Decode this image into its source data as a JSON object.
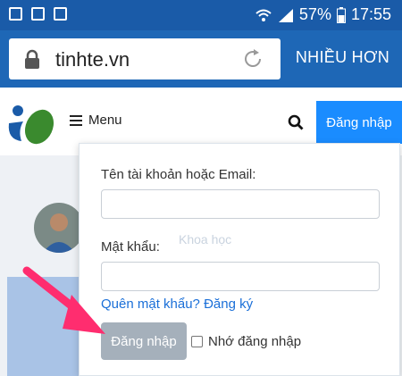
{
  "status": {
    "battery": "57%",
    "time": "17:55"
  },
  "browser": {
    "url": "tinhte.vn",
    "more_label": "NHIỀU HƠN"
  },
  "nav": {
    "menu_label": "Menu",
    "login_button": "Đăng nhập"
  },
  "login_form": {
    "username_label": "Tên tài khoản hoặc Email:",
    "username_value": "",
    "password_label": "Mật khẩu:",
    "password_value": "",
    "forgot_link": "Quên mật khẩu?",
    "register_link": "Đăng ký",
    "submit_label": "Đăng nhập",
    "remember_label": "Nhớ đăng nhập"
  },
  "background": {
    "ghost_text": "Khoa học"
  },
  "colors": {
    "brand_blue": "#1a8cff",
    "status_bar": "#1a5ba8",
    "url_bar": "#1e67b6",
    "link": "#1a6fd8",
    "annotation_arrow": "#ff2d6f"
  }
}
